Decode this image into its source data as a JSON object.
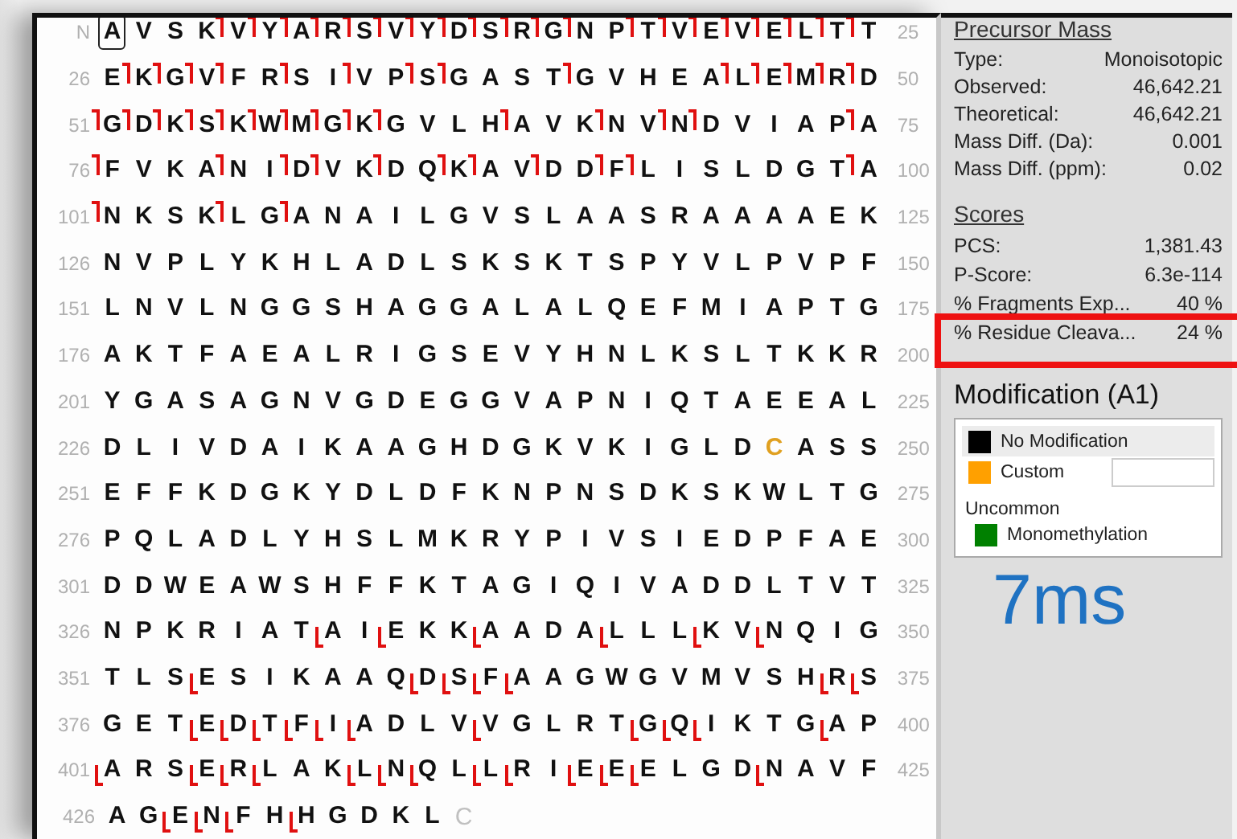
{
  "sequence": {
    "c_terminus": "C",
    "rows": [
      {
        "start": "N",
        "end": "25",
        "kind": "n_marks",
        "lead_cut": false,
        "residues": [
          {
            "aa": "A",
            "cut": false,
            "kind": "selected"
          },
          {
            "aa": "V",
            "cut": false
          },
          {
            "aa": "S",
            "cut": false
          },
          {
            "aa": "K",
            "cut": true
          },
          {
            "aa": "V",
            "cut": true
          },
          {
            "aa": "Y",
            "cut": true
          },
          {
            "aa": "A",
            "cut": true
          },
          {
            "aa": "R",
            "cut": true
          },
          {
            "aa": "S",
            "cut": true
          },
          {
            "aa": "V",
            "cut": true
          },
          {
            "aa": "Y",
            "cut": true
          },
          {
            "aa": "D",
            "cut": true
          },
          {
            "aa": "S",
            "cut": true
          },
          {
            "aa": "R",
            "cut": true
          },
          {
            "aa": "G",
            "cut": true
          },
          {
            "aa": "N",
            "cut": false
          },
          {
            "aa": "P",
            "cut": true
          },
          {
            "aa": "T",
            "cut": true
          },
          {
            "aa": "V",
            "cut": true
          },
          {
            "aa": "E",
            "cut": true
          },
          {
            "aa": "V",
            "cut": true
          },
          {
            "aa": "E",
            "cut": true
          },
          {
            "aa": "L",
            "cut": true
          },
          {
            "aa": "T",
            "cut": true
          },
          {
            "aa": "T",
            "cut": false
          }
        ]
      },
      {
        "start": "26",
        "end": "50",
        "kind": "n_marks",
        "lead_cut": false,
        "residues": [
          {
            "aa": "E",
            "cut": true
          },
          {
            "aa": "K",
            "cut": true
          },
          {
            "aa": "G",
            "cut": true
          },
          {
            "aa": "V",
            "cut": true
          },
          {
            "aa": "F",
            "cut": false
          },
          {
            "aa": "R",
            "cut": true
          },
          {
            "aa": "S",
            "cut": false
          },
          {
            "aa": "I",
            "cut": true
          },
          {
            "aa": "V",
            "cut": false
          },
          {
            "aa": "P",
            "cut": true
          },
          {
            "aa": "S",
            "cut": true
          },
          {
            "aa": "G",
            "cut": false
          },
          {
            "aa": "A",
            "cut": false
          },
          {
            "aa": "S",
            "cut": false
          },
          {
            "aa": "T",
            "cut": true
          },
          {
            "aa": "G",
            "cut": false
          },
          {
            "aa": "V",
            "cut": false
          },
          {
            "aa": "H",
            "cut": false
          },
          {
            "aa": "E",
            "cut": false
          },
          {
            "aa": "A",
            "cut": true
          },
          {
            "aa": "L",
            "cut": true
          },
          {
            "aa": "E",
            "cut": true
          },
          {
            "aa": "M",
            "cut": true
          },
          {
            "aa": "R",
            "cut": true
          },
          {
            "aa": "D",
            "cut": false
          }
        ]
      },
      {
        "start": "51",
        "end": "75",
        "kind": "n_marks",
        "lead_cut": true,
        "residues": [
          {
            "aa": "G",
            "cut": true
          },
          {
            "aa": "D",
            "cut": true
          },
          {
            "aa": "K",
            "cut": true
          },
          {
            "aa": "S",
            "cut": true
          },
          {
            "aa": "K",
            "cut": true
          },
          {
            "aa": "W",
            "cut": true
          },
          {
            "aa": "M",
            "cut": true
          },
          {
            "aa": "G",
            "cut": true
          },
          {
            "aa": "K",
            "cut": true
          },
          {
            "aa": "G",
            "cut": false
          },
          {
            "aa": "V",
            "cut": false
          },
          {
            "aa": "L",
            "cut": false
          },
          {
            "aa": "H",
            "cut": true
          },
          {
            "aa": "A",
            "cut": false
          },
          {
            "aa": "V",
            "cut": false
          },
          {
            "aa": "K",
            "cut": true
          },
          {
            "aa": "N",
            "cut": false
          },
          {
            "aa": "V",
            "cut": true
          },
          {
            "aa": "N",
            "cut": true
          },
          {
            "aa": "D",
            "cut": false
          },
          {
            "aa": "V",
            "cut": false
          },
          {
            "aa": "I",
            "cut": false
          },
          {
            "aa": "A",
            "cut": false
          },
          {
            "aa": "P",
            "cut": true
          },
          {
            "aa": "A",
            "cut": false
          }
        ]
      },
      {
        "start": "76",
        "end": "100",
        "kind": "n_marks",
        "lead_cut": true,
        "residues": [
          {
            "aa": "F",
            "cut": false
          },
          {
            "aa": "V",
            "cut": false
          },
          {
            "aa": "K",
            "cut": false
          },
          {
            "aa": "A",
            "cut": true
          },
          {
            "aa": "N",
            "cut": false
          },
          {
            "aa": "I",
            "cut": true
          },
          {
            "aa": "D",
            "cut": true
          },
          {
            "aa": "V",
            "cut": false
          },
          {
            "aa": "K",
            "cut": true
          },
          {
            "aa": "D",
            "cut": false
          },
          {
            "aa": "Q",
            "cut": true
          },
          {
            "aa": "K",
            "cut": true
          },
          {
            "aa": "A",
            "cut": false
          },
          {
            "aa": "V",
            "cut": true
          },
          {
            "aa": "D",
            "cut": false
          },
          {
            "aa": "D",
            "cut": true
          },
          {
            "aa": "F",
            "cut": true
          },
          {
            "aa": "L",
            "cut": false
          },
          {
            "aa": "I",
            "cut": false
          },
          {
            "aa": "S",
            "cut": false
          },
          {
            "aa": "L",
            "cut": false
          },
          {
            "aa": "D",
            "cut": false
          },
          {
            "aa": "G",
            "cut": false
          },
          {
            "aa": "T",
            "cut": true
          },
          {
            "aa": "A",
            "cut": false
          }
        ]
      },
      {
        "start": "101",
        "end": "125",
        "kind": "n_marks",
        "lead_cut": true,
        "residues": [
          {
            "aa": "N",
            "cut": false
          },
          {
            "aa": "K",
            "cut": false
          },
          {
            "aa": "S",
            "cut": false
          },
          {
            "aa": "K",
            "cut": true
          },
          {
            "aa": "L",
            "cut": false
          },
          {
            "aa": "G",
            "cut": true
          },
          {
            "aa": "A",
            "cut": false
          },
          {
            "aa": "N",
            "cut": false
          },
          {
            "aa": "A",
            "cut": false
          },
          {
            "aa": "I",
            "cut": false
          },
          {
            "aa": "L",
            "cut": false
          },
          {
            "aa": "G",
            "cut": false
          },
          {
            "aa": "V",
            "cut": false
          },
          {
            "aa": "S",
            "cut": false
          },
          {
            "aa": "L",
            "cut": false
          },
          {
            "aa": "A",
            "cut": false
          },
          {
            "aa": "A",
            "cut": false
          },
          {
            "aa": "S",
            "cut": false
          },
          {
            "aa": "R",
            "cut": false
          },
          {
            "aa": "A",
            "cut": false
          },
          {
            "aa": "A",
            "cut": false
          },
          {
            "aa": "A",
            "cut": false
          },
          {
            "aa": "A",
            "cut": false
          },
          {
            "aa": "E",
            "cut": false
          },
          {
            "aa": "K",
            "cut": false
          }
        ]
      },
      {
        "start": "126",
        "end": "150",
        "lead_cut": false,
        "residues": [
          {
            "aa": "N",
            "cut": false
          },
          {
            "aa": "V",
            "cut": false
          },
          {
            "aa": "P",
            "cut": false
          },
          {
            "aa": "L",
            "cut": false
          },
          {
            "aa": "Y",
            "cut": false
          },
          {
            "aa": "K",
            "cut": false
          },
          {
            "aa": "H",
            "cut": false
          },
          {
            "aa": "L",
            "cut": false
          },
          {
            "aa": "A",
            "cut": false
          },
          {
            "aa": "D",
            "cut": false
          },
          {
            "aa": "L",
            "cut": false
          },
          {
            "aa": "S",
            "cut": false
          },
          {
            "aa": "K",
            "cut": false
          },
          {
            "aa": "S",
            "cut": false
          },
          {
            "aa": "K",
            "cut": false
          },
          {
            "aa": "T",
            "cut": false
          },
          {
            "aa": "S",
            "cut": false
          },
          {
            "aa": "P",
            "cut": false
          },
          {
            "aa": "Y",
            "cut": false
          },
          {
            "aa": "V",
            "cut": false
          },
          {
            "aa": "L",
            "cut": false
          },
          {
            "aa": "P",
            "cut": false
          },
          {
            "aa": "V",
            "cut": false
          },
          {
            "aa": "P",
            "cut": false
          },
          {
            "aa": "F",
            "cut": false
          }
        ]
      },
      {
        "start": "151",
        "end": "175",
        "lead_cut": false,
        "residues": [
          {
            "aa": "L",
            "cut": false
          },
          {
            "aa": "N",
            "cut": false
          },
          {
            "aa": "V",
            "cut": false
          },
          {
            "aa": "L",
            "cut": false
          },
          {
            "aa": "N",
            "cut": false
          },
          {
            "aa": "G",
            "cut": false
          },
          {
            "aa": "G",
            "cut": false
          },
          {
            "aa": "S",
            "cut": false
          },
          {
            "aa": "H",
            "cut": false
          },
          {
            "aa": "A",
            "cut": false
          },
          {
            "aa": "G",
            "cut": false
          },
          {
            "aa": "G",
            "cut": false
          },
          {
            "aa": "A",
            "cut": false
          },
          {
            "aa": "L",
            "cut": false
          },
          {
            "aa": "A",
            "cut": false
          },
          {
            "aa": "L",
            "cut": false
          },
          {
            "aa": "Q",
            "cut": false
          },
          {
            "aa": "E",
            "cut": false
          },
          {
            "aa": "F",
            "cut": false
          },
          {
            "aa": "M",
            "cut": false
          },
          {
            "aa": "I",
            "cut": false
          },
          {
            "aa": "A",
            "cut": false
          },
          {
            "aa": "P",
            "cut": false
          },
          {
            "aa": "T",
            "cut": false
          },
          {
            "aa": "G",
            "cut": false
          }
        ]
      },
      {
        "start": "176",
        "end": "200",
        "lead_cut": false,
        "residues": [
          {
            "aa": "A",
            "cut": false
          },
          {
            "aa": "K",
            "cut": false
          },
          {
            "aa": "T",
            "cut": false
          },
          {
            "aa": "F",
            "cut": false
          },
          {
            "aa": "A",
            "cut": false
          },
          {
            "aa": "E",
            "cut": false
          },
          {
            "aa": "A",
            "cut": false
          },
          {
            "aa": "L",
            "cut": false
          },
          {
            "aa": "R",
            "cut": false
          },
          {
            "aa": "I",
            "cut": false
          },
          {
            "aa": "G",
            "cut": false
          },
          {
            "aa": "S",
            "cut": false
          },
          {
            "aa": "E",
            "cut": false
          },
          {
            "aa": "V",
            "cut": false
          },
          {
            "aa": "Y",
            "cut": false
          },
          {
            "aa": "H",
            "cut": false
          },
          {
            "aa": "N",
            "cut": false
          },
          {
            "aa": "L",
            "cut": false
          },
          {
            "aa": "K",
            "cut": false
          },
          {
            "aa": "S",
            "cut": false
          },
          {
            "aa": "L",
            "cut": false
          },
          {
            "aa": "T",
            "cut": false
          },
          {
            "aa": "K",
            "cut": false
          },
          {
            "aa": "K",
            "cut": false
          },
          {
            "aa": "R",
            "cut": false
          }
        ]
      },
      {
        "start": "201",
        "end": "225",
        "lead_cut": false,
        "residues": [
          {
            "aa": "Y",
            "cut": false
          },
          {
            "aa": "G",
            "cut": false
          },
          {
            "aa": "A",
            "cut": false
          },
          {
            "aa": "S",
            "cut": false
          },
          {
            "aa": "A",
            "cut": false
          },
          {
            "aa": "G",
            "cut": false
          },
          {
            "aa": "N",
            "cut": false
          },
          {
            "aa": "V",
            "cut": false
          },
          {
            "aa": "G",
            "cut": false
          },
          {
            "aa": "D",
            "cut": false
          },
          {
            "aa": "E",
            "cut": false
          },
          {
            "aa": "G",
            "cut": false
          },
          {
            "aa": "G",
            "cut": false
          },
          {
            "aa": "V",
            "cut": false
          },
          {
            "aa": "A",
            "cut": false
          },
          {
            "aa": "P",
            "cut": false
          },
          {
            "aa": "N",
            "cut": false
          },
          {
            "aa": "I",
            "cut": false
          },
          {
            "aa": "Q",
            "cut": false
          },
          {
            "aa": "T",
            "cut": false
          },
          {
            "aa": "A",
            "cut": false
          },
          {
            "aa": "E",
            "cut": false
          },
          {
            "aa": "E",
            "cut": false
          },
          {
            "aa": "A",
            "cut": false
          },
          {
            "aa": "L",
            "cut": false
          }
        ]
      },
      {
        "start": "226",
        "end": "250",
        "lead_cut": false,
        "residues": [
          {
            "aa": "D",
            "cut": false
          },
          {
            "aa": "L",
            "cut": false
          },
          {
            "aa": "I",
            "cut": false
          },
          {
            "aa": "V",
            "cut": false
          },
          {
            "aa": "D",
            "cut": false
          },
          {
            "aa": "A",
            "cut": false
          },
          {
            "aa": "I",
            "cut": false
          },
          {
            "aa": "K",
            "cut": false
          },
          {
            "aa": "A",
            "cut": false
          },
          {
            "aa": "A",
            "cut": false
          },
          {
            "aa": "G",
            "cut": false
          },
          {
            "aa": "H",
            "cut": false
          },
          {
            "aa": "D",
            "cut": false
          },
          {
            "aa": "G",
            "cut": false
          },
          {
            "aa": "K",
            "cut": false
          },
          {
            "aa": "V",
            "cut": false
          },
          {
            "aa": "K",
            "cut": false
          },
          {
            "aa": "I",
            "cut": false
          },
          {
            "aa": "G",
            "cut": false
          },
          {
            "aa": "L",
            "cut": false
          },
          {
            "aa": "D",
            "cut": false
          },
          {
            "aa": "C",
            "cut": false,
            "kind": "custom"
          },
          {
            "aa": "A",
            "cut": false
          },
          {
            "aa": "S",
            "cut": false
          },
          {
            "aa": "S",
            "cut": false
          }
        ]
      },
      {
        "start": "251",
        "end": "275",
        "lead_cut": false,
        "residues": [
          {
            "aa": "E",
            "cut": false
          },
          {
            "aa": "F",
            "cut": false
          },
          {
            "aa": "F",
            "cut": false
          },
          {
            "aa": "K",
            "cut": false
          },
          {
            "aa": "D",
            "cut": false
          },
          {
            "aa": "G",
            "cut": false
          },
          {
            "aa": "K",
            "cut": false
          },
          {
            "aa": "Y",
            "cut": false
          },
          {
            "aa": "D",
            "cut": false
          },
          {
            "aa": "L",
            "cut": false
          },
          {
            "aa": "D",
            "cut": false
          },
          {
            "aa": "F",
            "cut": false
          },
          {
            "aa": "K",
            "cut": false
          },
          {
            "aa": "N",
            "cut": false
          },
          {
            "aa": "P",
            "cut": false
          },
          {
            "aa": "N",
            "cut": false
          },
          {
            "aa": "S",
            "cut": false
          },
          {
            "aa": "D",
            "cut": false
          },
          {
            "aa": "K",
            "cut": false
          },
          {
            "aa": "S",
            "cut": false
          },
          {
            "aa": "K",
            "cut": false
          },
          {
            "aa": "W",
            "cut": false
          },
          {
            "aa": "L",
            "cut": false
          },
          {
            "aa": "T",
            "cut": false
          },
          {
            "aa": "G",
            "cut": false
          }
        ]
      },
      {
        "start": "276",
        "end": "300",
        "lead_cut": false,
        "residues": [
          {
            "aa": "P",
            "cut": false
          },
          {
            "aa": "Q",
            "cut": false
          },
          {
            "aa": "L",
            "cut": false
          },
          {
            "aa": "A",
            "cut": false
          },
          {
            "aa": "D",
            "cut": false
          },
          {
            "aa": "L",
            "cut": false
          },
          {
            "aa": "Y",
            "cut": false
          },
          {
            "aa": "H",
            "cut": false
          },
          {
            "aa": "S",
            "cut": false
          },
          {
            "aa": "L",
            "cut": false
          },
          {
            "aa": "M",
            "cut": false
          },
          {
            "aa": "K",
            "cut": false
          },
          {
            "aa": "R",
            "cut": false
          },
          {
            "aa": "Y",
            "cut": false
          },
          {
            "aa": "P",
            "cut": false
          },
          {
            "aa": "I",
            "cut": false
          },
          {
            "aa": "V",
            "cut": false
          },
          {
            "aa": "S",
            "cut": false
          },
          {
            "aa": "I",
            "cut": false
          },
          {
            "aa": "E",
            "cut": false
          },
          {
            "aa": "D",
            "cut": false
          },
          {
            "aa": "P",
            "cut": false
          },
          {
            "aa": "F",
            "cut": false
          },
          {
            "aa": "A",
            "cut": false
          },
          {
            "aa": "E",
            "cut": false
          }
        ]
      },
      {
        "start": "301",
        "end": "325",
        "lead_cut": false,
        "residues": [
          {
            "aa": "D",
            "cut": false
          },
          {
            "aa": "D",
            "cut": false
          },
          {
            "aa": "W",
            "cut": false
          },
          {
            "aa": "E",
            "cut": false
          },
          {
            "aa": "A",
            "cut": false
          },
          {
            "aa": "W",
            "cut": false
          },
          {
            "aa": "S",
            "cut": false
          },
          {
            "aa": "H",
            "cut": false
          },
          {
            "aa": "F",
            "cut": false
          },
          {
            "aa": "F",
            "cut": false
          },
          {
            "aa": "K",
            "cut": false
          },
          {
            "aa": "T",
            "cut": false
          },
          {
            "aa": "A",
            "cut": false
          },
          {
            "aa": "G",
            "cut": false
          },
          {
            "aa": "I",
            "cut": false
          },
          {
            "aa": "Q",
            "cut": false
          },
          {
            "aa": "I",
            "cut": false
          },
          {
            "aa": "V",
            "cut": false
          },
          {
            "aa": "A",
            "cut": false
          },
          {
            "aa": "D",
            "cut": false
          },
          {
            "aa": "D",
            "cut": false
          },
          {
            "aa": "L",
            "cut": false
          },
          {
            "aa": "T",
            "cut": false
          },
          {
            "aa": "V",
            "cut": false
          },
          {
            "aa": "T",
            "cut": false
          }
        ]
      },
      {
        "start": "326",
        "end": "350",
        "kind": "c_marks",
        "lead_cut": false,
        "residues": [
          {
            "aa": "N",
            "cut": false
          },
          {
            "aa": "P",
            "cut": false
          },
          {
            "aa": "K",
            "cut": false
          },
          {
            "aa": "R",
            "cut": false
          },
          {
            "aa": "I",
            "cut": false
          },
          {
            "aa": "A",
            "cut": false
          },
          {
            "aa": "T",
            "cut": false
          },
          {
            "aa": "A",
            "cut": true
          },
          {
            "aa": "I",
            "cut": false
          },
          {
            "aa": "E",
            "cut": true
          },
          {
            "aa": "K",
            "cut": false
          },
          {
            "aa": "K",
            "cut": false
          },
          {
            "aa": "A",
            "cut": true
          },
          {
            "aa": "A",
            "cut": false
          },
          {
            "aa": "D",
            "cut": false
          },
          {
            "aa": "A",
            "cut": false
          },
          {
            "aa": "L",
            "cut": true
          },
          {
            "aa": "L",
            "cut": false
          },
          {
            "aa": "L",
            "cut": false
          },
          {
            "aa": "K",
            "cut": true
          },
          {
            "aa": "V",
            "cut": false
          },
          {
            "aa": "N",
            "cut": true
          },
          {
            "aa": "Q",
            "cut": false
          },
          {
            "aa": "I",
            "cut": false
          },
          {
            "aa": "G",
            "cut": false
          }
        ]
      },
      {
        "start": "351",
        "end": "375",
        "kind": "c_marks",
        "lead_cut": false,
        "residues": [
          {
            "aa": "T",
            "cut": false
          },
          {
            "aa": "L",
            "cut": false
          },
          {
            "aa": "S",
            "cut": false
          },
          {
            "aa": "E",
            "cut": true
          },
          {
            "aa": "S",
            "cut": false
          },
          {
            "aa": "I",
            "cut": false
          },
          {
            "aa": "K",
            "cut": false
          },
          {
            "aa": "A",
            "cut": false
          },
          {
            "aa": "A",
            "cut": false
          },
          {
            "aa": "Q",
            "cut": false
          },
          {
            "aa": "D",
            "cut": true
          },
          {
            "aa": "S",
            "cut": true
          },
          {
            "aa": "F",
            "cut": true
          },
          {
            "aa": "A",
            "cut": true
          },
          {
            "aa": "A",
            "cut": false
          },
          {
            "aa": "G",
            "cut": false
          },
          {
            "aa": "W",
            "cut": false
          },
          {
            "aa": "G",
            "cut": false
          },
          {
            "aa": "V",
            "cut": false
          },
          {
            "aa": "M",
            "cut": false
          },
          {
            "aa": "V",
            "cut": false
          },
          {
            "aa": "S",
            "cut": false
          },
          {
            "aa": "H",
            "cut": false
          },
          {
            "aa": "R",
            "cut": true
          },
          {
            "aa": "S",
            "cut": true
          }
        ]
      },
      {
        "start": "376",
        "end": "400",
        "kind": "c_marks",
        "lead_cut": false,
        "residues": [
          {
            "aa": "G",
            "cut": false
          },
          {
            "aa": "E",
            "cut": false
          },
          {
            "aa": "T",
            "cut": false
          },
          {
            "aa": "E",
            "cut": true
          },
          {
            "aa": "D",
            "cut": true
          },
          {
            "aa": "T",
            "cut": true
          },
          {
            "aa": "F",
            "cut": true
          },
          {
            "aa": "I",
            "cut": true
          },
          {
            "aa": "A",
            "cut": true
          },
          {
            "aa": "D",
            "cut": false
          },
          {
            "aa": "L",
            "cut": false
          },
          {
            "aa": "V",
            "cut": false
          },
          {
            "aa": "V",
            "cut": true
          },
          {
            "aa": "G",
            "cut": false
          },
          {
            "aa": "L",
            "cut": false
          },
          {
            "aa": "R",
            "cut": false
          },
          {
            "aa": "T",
            "cut": false
          },
          {
            "aa": "G",
            "cut": true
          },
          {
            "aa": "Q",
            "cut": true
          },
          {
            "aa": "I",
            "cut": true
          },
          {
            "aa": "K",
            "cut": false
          },
          {
            "aa": "T",
            "cut": false
          },
          {
            "aa": "G",
            "cut": false
          },
          {
            "aa": "A",
            "cut": true
          },
          {
            "aa": "P",
            "cut": false
          }
        ]
      },
      {
        "start": "401",
        "end": "425",
        "kind": "c_marks",
        "lead_cut": false,
        "residues": [
          {
            "aa": "A",
            "cut": true
          },
          {
            "aa": "R",
            "cut": false
          },
          {
            "aa": "S",
            "cut": false
          },
          {
            "aa": "E",
            "cut": true
          },
          {
            "aa": "R",
            "cut": true
          },
          {
            "aa": "L",
            "cut": true
          },
          {
            "aa": "A",
            "cut": false
          },
          {
            "aa": "K",
            "cut": false
          },
          {
            "aa": "L",
            "cut": true
          },
          {
            "aa": "N",
            "cut": true
          },
          {
            "aa": "Q",
            "cut": true
          },
          {
            "aa": "L",
            "cut": false
          },
          {
            "aa": "L",
            "cut": true
          },
          {
            "aa": "R",
            "cut": true
          },
          {
            "aa": "I",
            "cut": false
          },
          {
            "aa": "E",
            "cut": true
          },
          {
            "aa": "E",
            "cut": true
          },
          {
            "aa": "E",
            "cut": true
          },
          {
            "aa": "L",
            "cut": false
          },
          {
            "aa": "G",
            "cut": false
          },
          {
            "aa": "D",
            "cut": false
          },
          {
            "aa": "N",
            "cut": true
          },
          {
            "aa": "A",
            "cut": false
          },
          {
            "aa": "V",
            "cut": false
          },
          {
            "aa": "F",
            "cut": false
          }
        ]
      },
      {
        "start": "426",
        "kind": "c_marks",
        "lead_cut": false,
        "residues": [
          {
            "aa": "A",
            "cut": false
          },
          {
            "aa": "G",
            "cut": false
          },
          {
            "aa": "E",
            "cut": true
          },
          {
            "aa": "N",
            "cut": true
          },
          {
            "aa": "F",
            "cut": true
          },
          {
            "aa": "H",
            "cut": false
          },
          {
            "aa": "H",
            "cut": true
          },
          {
            "aa": "G",
            "cut": false
          },
          {
            "aa": "D",
            "cut": false
          },
          {
            "aa": "K",
            "cut": false
          },
          {
            "aa": "L",
            "cut": false
          }
        ]
      }
    ]
  },
  "precursor_mass": {
    "title": "Precursor Mass",
    "rows": [
      {
        "label": "Type:",
        "value": "Monoisotopic"
      },
      {
        "label": "Observed:",
        "value": "46,642.21"
      },
      {
        "label": "Theoretical:",
        "value": "46,642.21"
      },
      {
        "label": "Mass Diff. (Da):",
        "value": "0.001"
      },
      {
        "label": "Mass Diff. (ppm):",
        "value": "0.02"
      }
    ]
  },
  "scores": {
    "title": "Scores",
    "rows": [
      {
        "label": "PCS:",
        "value": "1,381.43",
        "highlighted": false
      },
      {
        "label": "P-Score:",
        "value": "6.3e-114",
        "highlighted": false
      },
      {
        "label": "% Fragments Exp...",
        "value": "40 %",
        "highlighted": false
      },
      {
        "label": "% Residue Cleava...",
        "value": "24 %",
        "highlighted": true
      }
    ]
  },
  "modification": {
    "title": "Modification (A1)",
    "items": [
      {
        "kind": "option",
        "label": "No Modification",
        "color": "#000000",
        "selected": true
      },
      {
        "kind": "custom",
        "label": "Custom",
        "color": "#ffa000",
        "selected": false
      },
      {
        "kind": "group",
        "label": "Uncommon"
      },
      {
        "kind": "option",
        "label": "Monomethylation",
        "color": "#008000",
        "selected": false
      }
    ]
  },
  "timing": "7ms"
}
